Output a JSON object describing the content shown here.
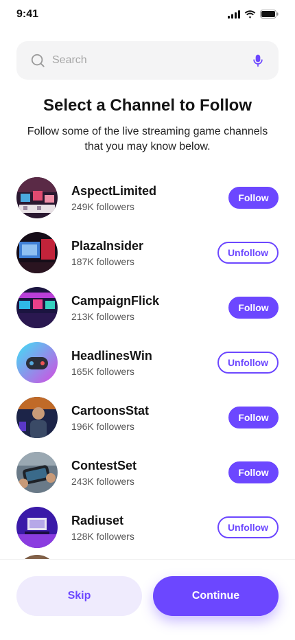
{
  "status_bar": {
    "time": "9:41"
  },
  "search": {
    "placeholder": "Search",
    "value": ""
  },
  "header": {
    "title": "Select a Channel to Follow",
    "subtitle": "Follow some of the live streaming game channels that you may know below."
  },
  "channels": [
    {
      "name": "AspectLimited",
      "followers": "249K followers",
      "action": "Follow"
    },
    {
      "name": "PlazaInsider",
      "followers": "187K followers",
      "action": "Unfollow"
    },
    {
      "name": "CampaignFlick",
      "followers": "213K followers",
      "action": "Follow"
    },
    {
      "name": "HeadlinesWin",
      "followers": "165K followers",
      "action": "Unfollow"
    },
    {
      "name": "CartoonsStat",
      "followers": "196K followers",
      "action": "Follow"
    },
    {
      "name": "ContestSet",
      "followers": "243K followers",
      "action": "Follow"
    },
    {
      "name": "Radiuset",
      "followers": "128K followers",
      "action": "Unfollow"
    }
  ],
  "footer": {
    "skip_label": "Skip",
    "continue_label": "Continue"
  },
  "colors": {
    "accent": "#6c47ff",
    "accent_light": "#efebfd",
    "search_bg": "#f4f4f5"
  }
}
